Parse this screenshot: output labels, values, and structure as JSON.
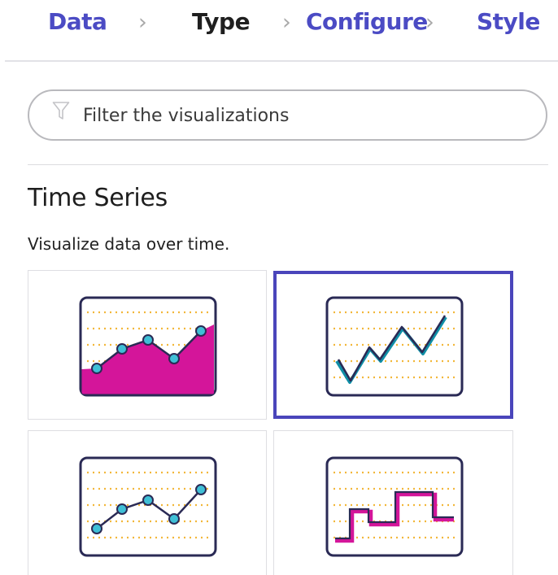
{
  "wizard": {
    "steps": [
      {
        "label": "Data",
        "state": "link"
      },
      {
        "label": "Type",
        "state": "current"
      },
      {
        "label": "Configure",
        "state": "link"
      },
      {
        "label": "Style",
        "state": "link"
      }
    ],
    "link_color": "#4b4bc4",
    "current_color": "#1f1f1f"
  },
  "filter": {
    "placeholder": "Filter the visualizations",
    "value": "",
    "icon": "funnel-icon"
  },
  "section": {
    "title": "Time Series",
    "description": "Visualize data over time."
  },
  "tiles": [
    {
      "icon": "area-chart-icon",
      "selected": false
    },
    {
      "icon": "line-chart-icon",
      "selected": true
    },
    {
      "icon": "line-points-chart-icon",
      "selected": false
    },
    {
      "icon": "step-chart-icon",
      "selected": false
    }
  ],
  "colors": {
    "selected_border": "#4a45bb",
    "icon_frame": "#2a2a55",
    "icon_grid": "#f2b73a",
    "accent_magenta": "#d4159a",
    "point_fill": "#3fbfd6"
  }
}
